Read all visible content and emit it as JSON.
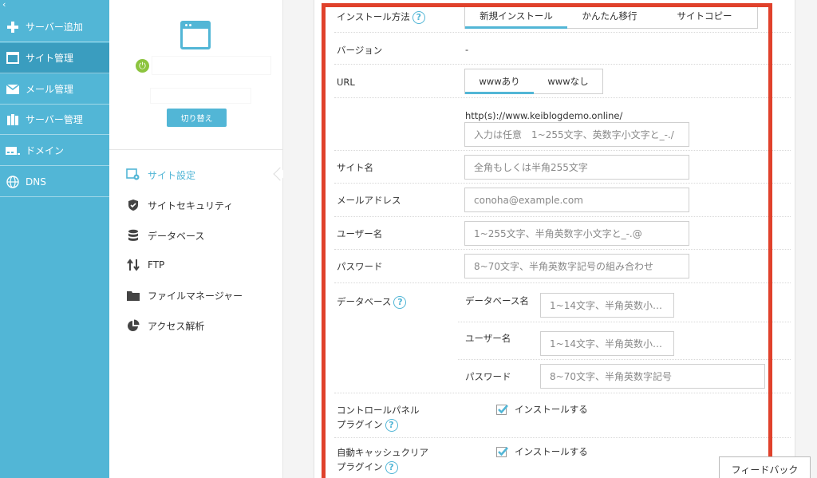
{
  "sidebar": {
    "collapse_glyph": "‹",
    "items": [
      {
        "label": "サーバー追加",
        "icon": "plus-icon"
      },
      {
        "label": "サイト管理",
        "icon": "window-icon"
      },
      {
        "label": "メール管理",
        "icon": "mail-icon"
      },
      {
        "label": "サーバー管理",
        "icon": "server-icon"
      },
      {
        "label": "ドメイン",
        "icon": "domain-icon"
      },
      {
        "label": "DNS",
        "icon": "globe-icon"
      }
    ]
  },
  "panel": {
    "switch_label": "切り替え",
    "menu": [
      {
        "label": "サイト設定",
        "icon": "site-settings-icon"
      },
      {
        "label": "サイトセキュリティ",
        "icon": "shield-icon"
      },
      {
        "label": "データベース",
        "icon": "database-icon"
      },
      {
        "label": "FTP",
        "icon": "transfer-arrows-icon"
      },
      {
        "label": "ファイルマネージャー",
        "icon": "folder-icon"
      },
      {
        "label": "アクセス解析",
        "icon": "pie-chart-icon"
      }
    ]
  },
  "form": {
    "install_method": {
      "label": "インストール方法",
      "tabs": [
        "新規インストール",
        "かんたん移行",
        "サイトコピー"
      ]
    },
    "version": {
      "label": "バージョン",
      "value": "-"
    },
    "url": {
      "label": "URL",
      "tabs": [
        "wwwあり",
        "wwwなし"
      ],
      "prefix": "http(s)://www.keiblogdemo.online/",
      "placeholder": "入力は任意　1~255文字、英数字小文字と_-./"
    },
    "site_name": {
      "label": "サイト名",
      "placeholder": "全角もしくは半角255文字"
    },
    "email": {
      "label": "メールアドレス",
      "placeholder": "conoha@example.com"
    },
    "username": {
      "label": "ユーザー名",
      "placeholder": "1~255文字、半角英数字小文字と_-.@"
    },
    "password": {
      "label": "パスワード",
      "placeholder": "8~70文字、半角英数字記号の組み合わせ"
    },
    "database": {
      "label": "データベース",
      "db_name_label": "データベース名",
      "db_name_placeholder": "1~14文字、半角英数小…",
      "db_user_label": "ユーザー名",
      "db_user_placeholder": "1~14文字、半角英数小…",
      "db_pass_label": "パスワード",
      "db_pass_placeholder": "8~70文字、半角英数字記号"
    },
    "cp_plugin": {
      "label_line1": "コントロールパネル",
      "label_line2": "プラグイン",
      "checkbox_label": "インストールする"
    },
    "cache_plugin": {
      "label_line1": "自動キャッシュクリア",
      "label_line2": "プラグイン",
      "checkbox_label": "インストールする"
    }
  },
  "help_glyph": "?",
  "feedback_label": "フィードバック",
  "colors": {
    "accent": "#52b6d6",
    "sidebar_active": "#3a9dbf",
    "highlight": "#e0412b",
    "power": "#8cc43f"
  }
}
